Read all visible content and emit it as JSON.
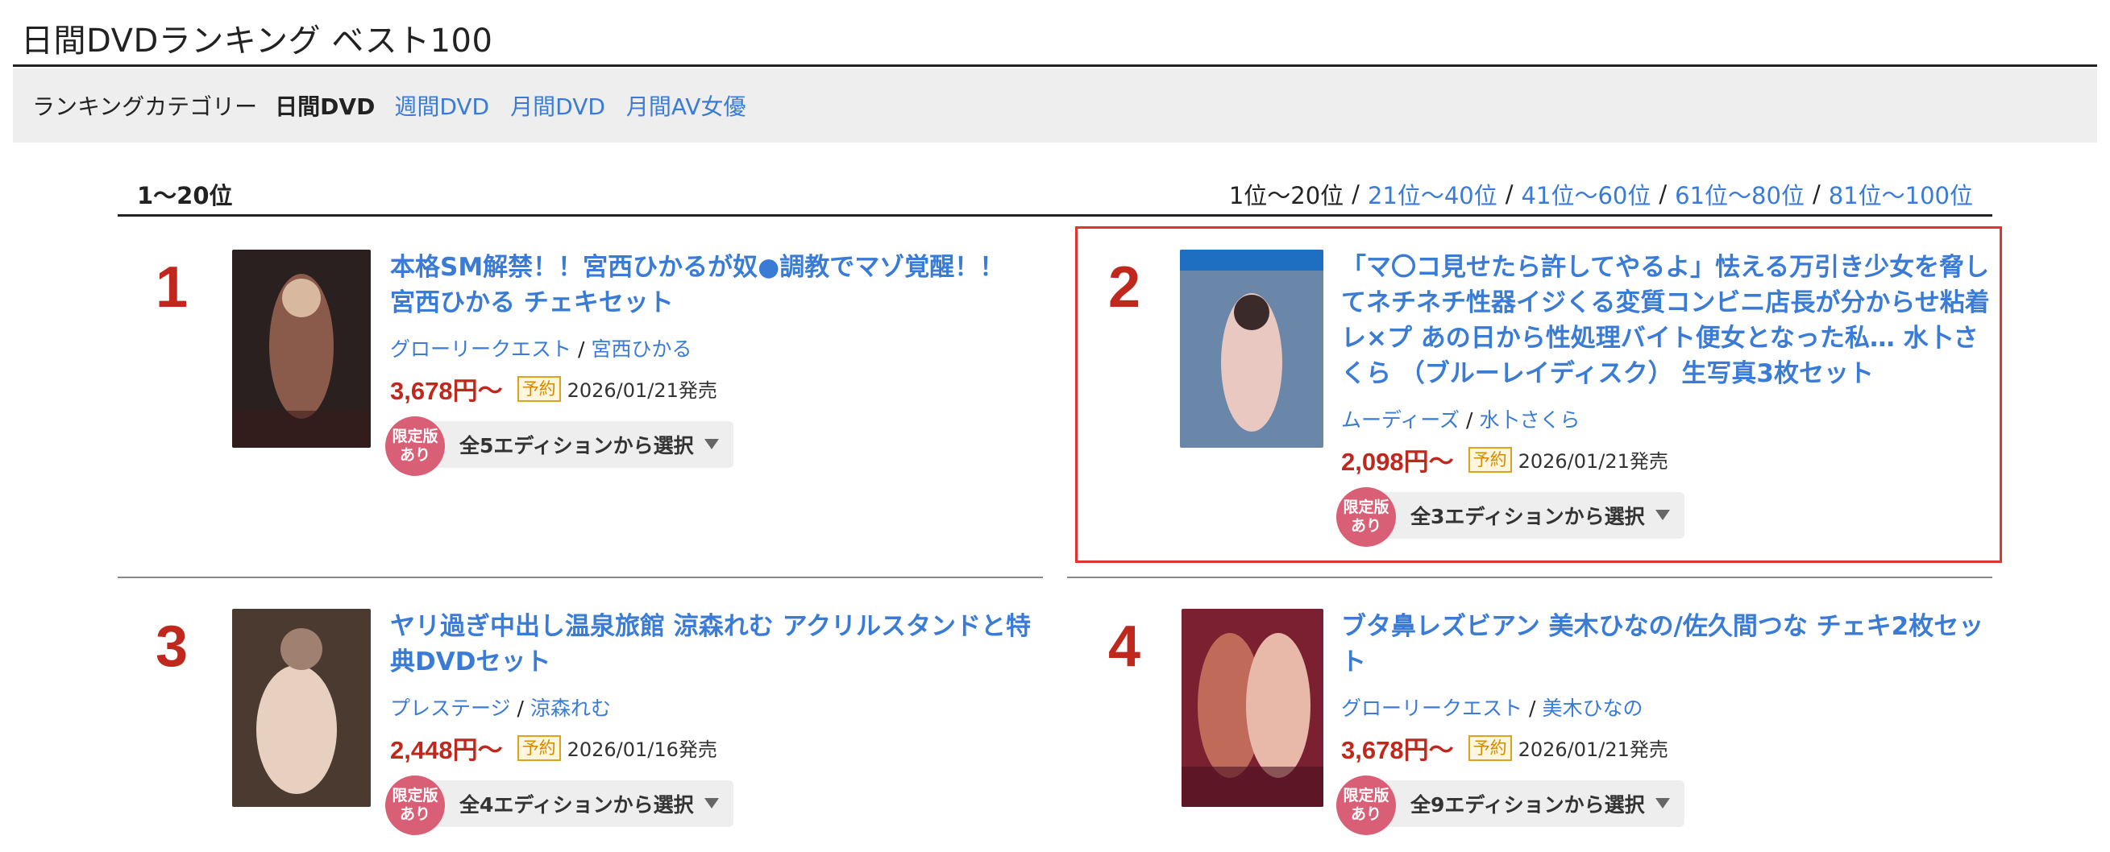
{
  "page": {
    "title": "日間DVDランキング ベスト100"
  },
  "categories": {
    "label": "ランキングカテゴリー",
    "current": "日間DVD",
    "links": [
      "週間DVD",
      "月間DVD",
      "月間AV女優"
    ]
  },
  "range": {
    "current": "1〜20位",
    "nav_current": "1位〜20位",
    "links": [
      "21位〜40位",
      "41位〜60位",
      "61位〜80位",
      "81位〜100位"
    ],
    "separator": "/"
  },
  "items": [
    {
      "rank": "1",
      "title": "本格SM解禁！！宮西ひかるが奴●調教でマゾ覚醒！！ 宮西ひかる チェキセット",
      "maker": "グローリークエスト",
      "actress": "宮西ひかる",
      "price": "3,678円〜",
      "status": "予約",
      "release": "2026/01/21発売",
      "limited_line1": "限定版",
      "limited_line2": "あり",
      "edition": "全5エディションから選択",
      "cover_colors": [
        "#2a2020",
        "#8a5a4a",
        "#d9b8a0"
      ]
    },
    {
      "rank": "2",
      "title": "「マ〇コ見せたら許してやるよ」怯える万引き少女を脅してネチネチ性器イジくる変質コンビニ店長が分からせ粘着レ×プ あの日から性処理バイト便女となった私… 水卜さくら （ブルーレイディスク） 生写真3枚セット",
      "maker": "ムーディーズ",
      "actress": "水卜さくら",
      "price": "2,098円〜",
      "status": "予約",
      "release": "2026/01/21発売",
      "limited_line1": "限定版",
      "limited_line2": "あり",
      "edition": "全3エディションから選択",
      "cover_colors": [
        "#1e6fc2",
        "#6a86a8",
        "#e8c8c0"
      ]
    },
    {
      "rank": "3",
      "title": "ヤリ過ぎ中出し温泉旅館 涼森れむ アクリルスタンドと特典DVDセット",
      "maker": "プレステージ",
      "actress": "涼森れむ",
      "price": "2,448円〜",
      "status": "予約",
      "release": "2026/01/16発売",
      "limited_line1": "限定版",
      "limited_line2": "あり",
      "edition": "全4エディションから選択",
      "cover_colors": [
        "#4a3a30",
        "#a08070",
        "#e8d0c0"
      ]
    },
    {
      "rank": "4",
      "title": "ブタ鼻レズビアン 美木ひなの/佐久間つな チェキ2枚セット",
      "maker": "グローリークエスト",
      "actress": "美木ひなの",
      "price": "3,678円〜",
      "status": "予約",
      "release": "2026/01/21発売",
      "limited_line1": "限定版",
      "limited_line2": "あり",
      "edition": "全9エディションから選択",
      "cover_colors": [
        "#7a2030",
        "#c06a5a",
        "#e8b8a8"
      ]
    }
  ]
}
